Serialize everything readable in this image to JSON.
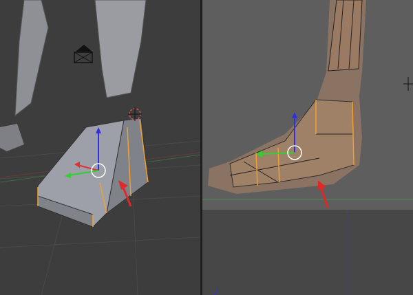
{
  "app": {
    "type": "3d-modeling-viewport"
  },
  "colors": {
    "viewport_bg": "#3d3d3d",
    "reference_bg": "#5e5e5e",
    "mesh": "#8f9096",
    "edge_selected": "#f0a030",
    "axis_x": "#e03030",
    "axis_y": "#30d030",
    "axis_z": "#3030e0",
    "annotation_arrow": "#e02828",
    "skin": "#9a7a62"
  },
  "icons": {
    "cursor": "3d-cursor-icon",
    "camera": "camera-icon",
    "manipulator": "transform-manipulator-icon",
    "arrow": "annotation-arrow-icon"
  }
}
